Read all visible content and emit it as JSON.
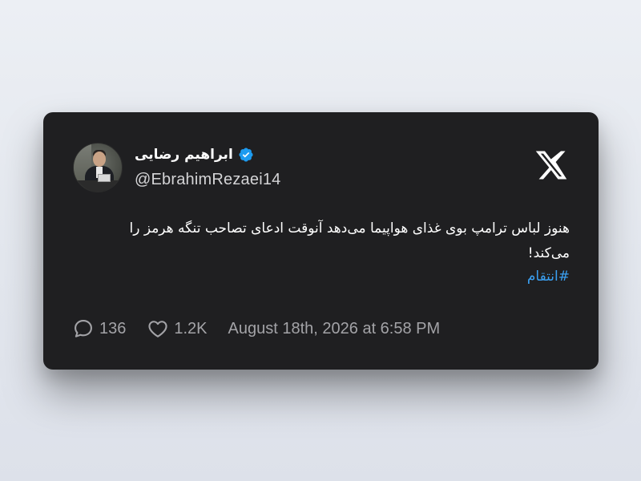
{
  "tweet": {
    "author": {
      "display_name": "ابراهیم رضایی",
      "handle": "@EbrahimRezaei14",
      "verified": true,
      "avatar_icon": "profile-photo"
    },
    "platform_icon": "x-logo-icon",
    "text_line1": "هنوز لباس ترامپ بوی غذای هواپیما می‌دهد آنوقت ادعای تصاحب تنگه هرمز را",
    "text_line2": "می‌کند!",
    "hashtag": "#انتقام",
    "replies": "136",
    "likes": "1.2K",
    "timestamp": "August 18th, 2026 at 6:58 PM"
  },
  "colors": {
    "card_background": "#1f1f21",
    "page_background": "#e6e9ef",
    "hashtag": "#3aa0f2",
    "verified_badge": "#1d9bf0",
    "meta_text": "#a3a3a7"
  }
}
